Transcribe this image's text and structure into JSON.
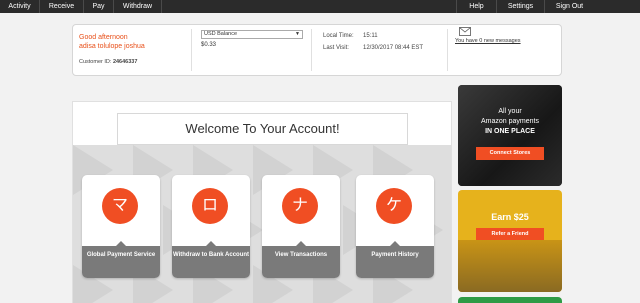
{
  "nav": {
    "left": [
      "Activity",
      "Receive",
      "Pay",
      "Withdraw"
    ],
    "right": [
      "Help",
      "Settings",
      "Sign Out"
    ]
  },
  "account": {
    "greeting": "Good afternoon",
    "name": "adisa tolulope joshua",
    "customer_id_label": "Customer ID:",
    "customer_id": "24646337",
    "balance_select": "USD Balance",
    "balance": "$0.33",
    "local_time_label": "Local Time:",
    "local_time": "15:11",
    "last_visit_label": "Last Visit:",
    "last_visit": "12/30/2017 08:44 EST",
    "messages_link": "You have 0 new messages"
  },
  "welcome": {
    "title": "Welcome To Your Account!",
    "tiles": [
      {
        "icon": "マ",
        "label": "Global Payment Service"
      },
      {
        "icon": "ロ",
        "label": "Withdraw to Bank Account"
      },
      {
        "icon": "ナ",
        "label": "View Transactions"
      },
      {
        "icon": "ケ",
        "label": "Payment History"
      }
    ]
  },
  "ads": {
    "ad1_line1": "All your",
    "ad1_line2": "Amazon payments",
    "ad1_line3": "IN ONE PLACE",
    "ad1_button": "Connect Stores",
    "ad2_title": "Earn $25",
    "ad2_button": "Refer a Friend"
  },
  "colors": {
    "accent": "#f04e23",
    "nav_bg": "#2b2b2b",
    "tile_footer": "#7a7a7a"
  }
}
